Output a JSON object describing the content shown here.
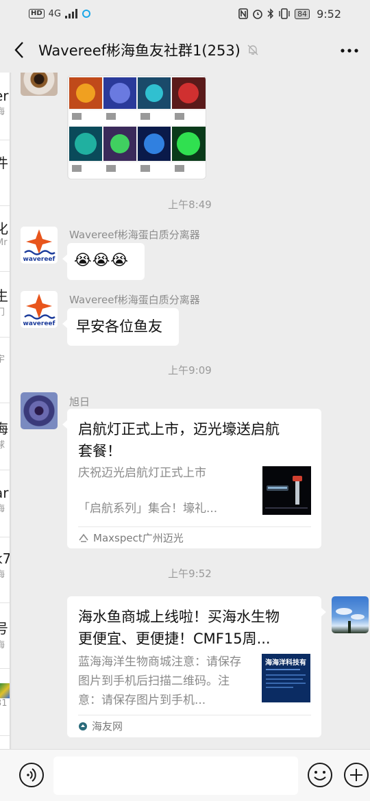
{
  "status_bar": {
    "left_badge": "HD",
    "network": "4G",
    "time": "9:52",
    "battery": "84"
  },
  "header": {
    "title": "Wavereef彬海鱼友社群1(253)"
  },
  "left_list_fragments": [
    {
      "a": "er",
      "b": "海"
    },
    {
      "a": "件",
      "b": ""
    },
    {
      "a": "化",
      "b": "Mr"
    },
    {
      "a": "生",
      "b": "门"
    },
    {
      "a": "",
      "b": "宇"
    },
    {
      "a": "海",
      "b": "球"
    },
    {
      "a": "ar",
      "b": "海"
    },
    {
      "a": "k7",
      "b": "海"
    },
    {
      "a": "号",
      "b": "海"
    },
    {
      "a": "",
      "b": "31"
    }
  ],
  "chat": {
    "timestamps": [
      "上午8:49",
      "上午9:09",
      "上午9:52"
    ],
    "messages": [
      {
        "sender": "Wavereef彬海蛋白质分离器",
        "emoji": "😭😭😭"
      },
      {
        "sender": "Wavereef彬海蛋白质分离器",
        "text": "早安各位鱼友"
      },
      {
        "sender": "旭日",
        "card_title": "启航灯正式上市，迈光壕送启航套餐！",
        "card_desc_1": "庆祝迈光启航灯正式上市",
        "card_desc_2": "「启航系列」集合！壕礼...",
        "card_source": "Maxspect广州迈光"
      },
      {
        "card_title": "海水鱼商城上线啦！买海水生物更便宜、更便捷！CMF15周...",
        "card_desc": "蓝海海洋生物商城注意：请保存图片到手机后扫描二维码。注意：请保存图片到手机...",
        "card_thumb_text": "海海洋科技有",
        "card_source": "海友网"
      }
    ],
    "avatar_logo_text": "wavereef"
  },
  "input_bar": {
    "placeholder": ""
  },
  "colors": {
    "background": "#ededed",
    "bubble": "#ffffff",
    "timestamp": "#9a9a9a"
  }
}
